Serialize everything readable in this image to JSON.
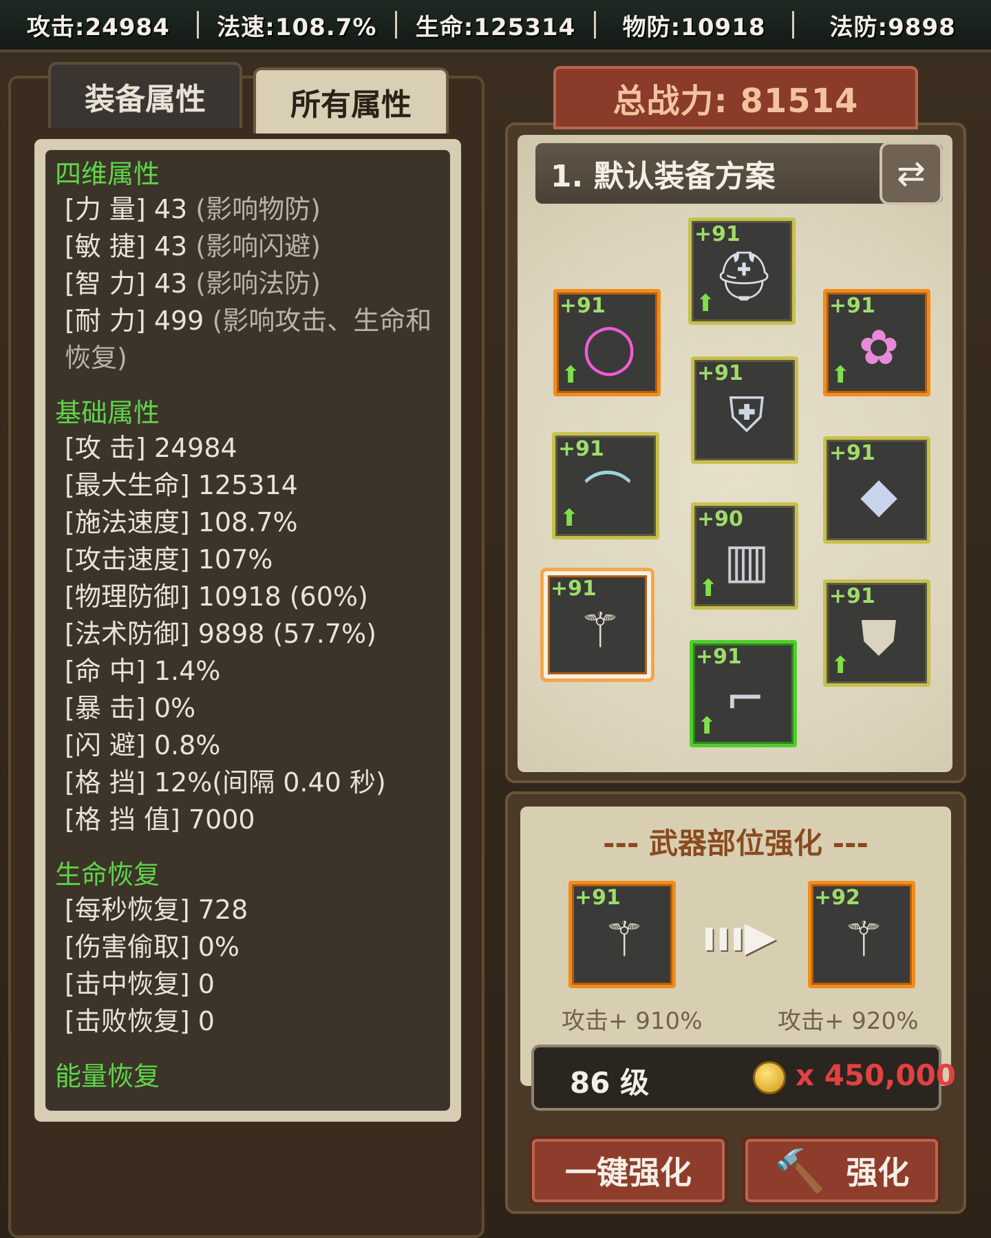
{
  "topbar": {
    "attack": "攻击:24984",
    "spell_speed": "法速:108.7%",
    "hp": "生命:125314",
    "phys_def": "物防:10918",
    "magic_def": "法防:9898"
  },
  "tabs": {
    "equip_attr": "装备属性",
    "all_attr": "所有属性"
  },
  "stats": {
    "four_dim": {
      "title": "四维属性",
      "rows": [
        {
          "label": "[力  量]",
          "value": "43",
          "hint": "(影响物防)"
        },
        {
          "label": "[敏  捷]",
          "value": "43",
          "hint": "(影响闪避)"
        },
        {
          "label": "[智  力]",
          "value": "43",
          "hint": "(影响法防)"
        },
        {
          "label": "[耐  力]",
          "value": "499",
          "hint": "(影响攻击、生命和恢复)"
        }
      ]
    },
    "base": {
      "title": "基础属性",
      "rows": [
        {
          "label": "[攻      击]",
          "value": "24984"
        },
        {
          "label": "[最大生命]",
          "value": "125314"
        },
        {
          "label": "[施法速度]",
          "value": "108.7%"
        },
        {
          "label": "[攻击速度]",
          "value": "107%"
        },
        {
          "label": "[物理防御]",
          "value": "10918 (60%)"
        },
        {
          "label": "[法术防御]",
          "value": "9898 (57.7%)"
        },
        {
          "label": "[命      中]",
          "value": "1.4%"
        },
        {
          "label": "[暴      击]",
          "value": "0%"
        },
        {
          "label": "[闪      避]",
          "value": "0.8%"
        },
        {
          "label": "[格      挡]",
          "value": "12%(间隔 0.40 秒)"
        },
        {
          "label": "[格  挡  值]",
          "value": "7000"
        }
      ]
    },
    "regen": {
      "title": "生命恢复",
      "rows": [
        {
          "label": "[每秒恢复]",
          "value": "728"
        },
        {
          "label": "[伤害偷取]",
          "value": "0%"
        },
        {
          "label": "[击中恢复]",
          "value": "0"
        },
        {
          "label": "[击败恢复]",
          "value": "0"
        }
      ]
    },
    "energy_title": "能量恢复"
  },
  "power": "总战力: 81514",
  "plan": {
    "name": "1. 默认装备方案",
    "swap_icon": "⇄"
  },
  "slots": [
    {
      "name": "helmet",
      "level": "+91",
      "icon": "⛑"
    },
    {
      "name": "ring",
      "level": "+91",
      "icon": "◯"
    },
    {
      "name": "necklace",
      "level": "+91",
      "icon": "✿"
    },
    {
      "name": "armor",
      "level": "+91",
      "icon": "⛨"
    },
    {
      "name": "belt",
      "level": "+91",
      "icon": "⌒"
    },
    {
      "name": "shoulder",
      "level": "+91",
      "icon": "◆"
    },
    {
      "name": "pants",
      "level": "+90",
      "icon": "▥"
    },
    {
      "name": "weapon",
      "level": "+91",
      "icon": "⚚"
    },
    {
      "name": "shield",
      "level": "+91",
      "icon": "⛊"
    },
    {
      "name": "boots",
      "level": "+91",
      "icon": "⌐"
    }
  ],
  "enhance": {
    "title": "--- 武器部位强化 ---",
    "from_level": "+91",
    "to_level": "+92",
    "from_attack": "攻击+ 910%",
    "to_attack": "攻击+ 920%",
    "arrow": "ııı▶",
    "required_level": "86 级",
    "cost": "x 450,000",
    "one_click_label": "一键强化",
    "enhance_label": "强化"
  }
}
